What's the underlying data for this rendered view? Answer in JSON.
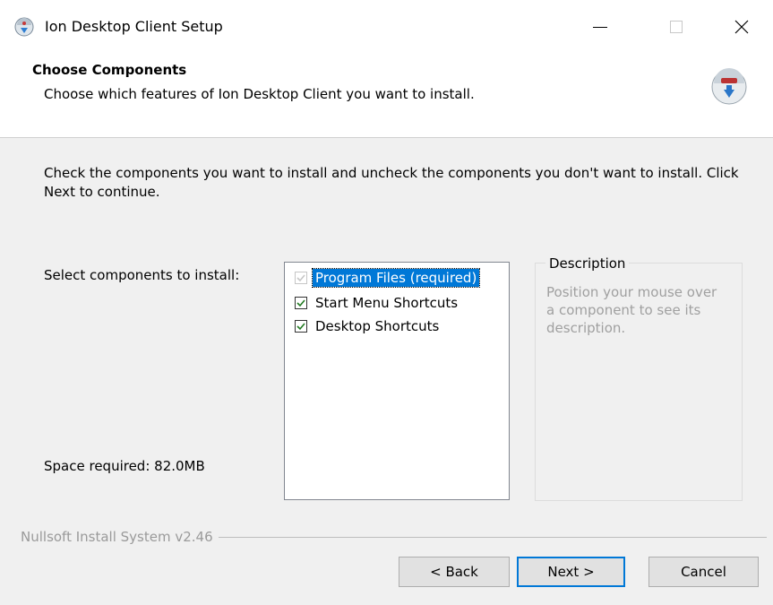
{
  "window": {
    "title": "Ion Desktop Client Setup",
    "icon": "app-installer-icon",
    "controls": {
      "minimize": "minimize-icon",
      "maximize": "maximize-icon",
      "close": "close-icon"
    }
  },
  "header": {
    "title": "Choose Components",
    "subtitle": "Choose which features of Ion Desktop Client you want to install.",
    "logo": "nsis-logo-icon"
  },
  "content": {
    "intro": "Check the components you want to install and uncheck the components you don't want to install. Click Next to continue.",
    "select_label": "Select components to install:",
    "space_required": "Space required: 82.0MB",
    "components": [
      {
        "label": "Program Files (required)",
        "checked": true,
        "disabled": true,
        "selected": true
      },
      {
        "label": "Start Menu Shortcuts",
        "checked": true,
        "disabled": false,
        "selected": false
      },
      {
        "label": "Desktop Shortcuts",
        "checked": true,
        "disabled": false,
        "selected": false
      }
    ],
    "description": {
      "legend": "Description",
      "text": "Position your mouse over a component to see its description."
    }
  },
  "footer": {
    "brand": "Nullsoft Install System v2.46",
    "buttons": {
      "back": "< Back",
      "next": "Next >",
      "cancel": "Cancel"
    }
  },
  "colors": {
    "accent": "#0078d7",
    "content_bg": "#f0f0f0",
    "check": "#217a21"
  }
}
